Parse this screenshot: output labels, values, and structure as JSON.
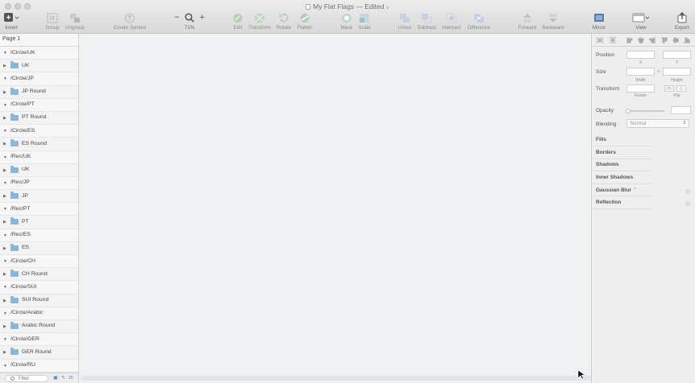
{
  "window": {
    "title": "My Flat Flags — Edited",
    "title_caret": "∨"
  },
  "toolbar": {
    "insert": "Insert",
    "group": "Group",
    "ungroup": "Ungroup",
    "create_symbol": "Create Symbol",
    "zoom": "71%",
    "edit": "Edit",
    "transform": "Transform",
    "rotate": "Rotate",
    "flatten": "Flatten",
    "mask": "Mask",
    "scale": "Scale",
    "union": "Union",
    "subtract": "Subtract",
    "intersect": "Intersect",
    "difference": "Difference",
    "forward": "Forward",
    "backward": "Backward",
    "mirror": "Mirror",
    "view": "View",
    "export": "Export",
    "zoom_minus": "−",
    "zoom_plus": "+"
  },
  "layers": {
    "page": "Page 1",
    "items": [
      {
        "label": "/Circle/UK",
        "kind": "group"
      },
      {
        "label": "UK",
        "kind": "folder"
      },
      {
        "label": "/Circle/JP",
        "kind": "group"
      },
      {
        "label": "JP Round",
        "kind": "folder"
      },
      {
        "label": "/Circle/PT",
        "kind": "group"
      },
      {
        "label": "PT Round",
        "kind": "folder"
      },
      {
        "label": "/Circle/ES",
        "kind": "group"
      },
      {
        "label": "ES Round",
        "kind": "folder"
      },
      {
        "label": "/Rec/UK",
        "kind": "group"
      },
      {
        "label": "UK",
        "kind": "folder"
      },
      {
        "label": "/Rec/JP",
        "kind": "group"
      },
      {
        "label": "JP",
        "kind": "folder"
      },
      {
        "label": "/Rec/PT",
        "kind": "group"
      },
      {
        "label": "PT",
        "kind": "folder"
      },
      {
        "label": "/Rec/ES",
        "kind": "group"
      },
      {
        "label": "ES",
        "kind": "folder"
      },
      {
        "label": "/Circle/CH",
        "kind": "group"
      },
      {
        "label": "CH Round",
        "kind": "folder"
      },
      {
        "label": "/Circle/SUI",
        "kind": "group"
      },
      {
        "label": "SUI Round",
        "kind": "folder"
      },
      {
        "label": "/Circle/Arabic",
        "kind": "group"
      },
      {
        "label": "Arabic Round",
        "kind": "folder"
      },
      {
        "label": "/Circle/GER",
        "kind": "group"
      },
      {
        "label": "GER Round",
        "kind": "folder"
      },
      {
        "label": "/Circle/RU",
        "kind": "group"
      }
    ],
    "filter_placeholder": "Filter",
    "count": "25"
  },
  "inspector": {
    "position": "Position",
    "x": "X",
    "y": "Y",
    "size": "Size",
    "width": "Width",
    "height": "Height",
    "transform": "Transform",
    "rotate": "Rotate",
    "flip": "Flip",
    "opacity": "Opacity",
    "blending": "Blending",
    "blending_value": "Normal",
    "sections": [
      "Fills",
      "Borders",
      "Shadows",
      "Inner Shadows",
      "Gaussian Blur",
      "Reflection"
    ],
    "gaussian_caret": "⌃"
  },
  "colors": {
    "canvas": "#eef2f3",
    "folder": "#8ab6d8",
    "accent": "#4a7fc2"
  }
}
